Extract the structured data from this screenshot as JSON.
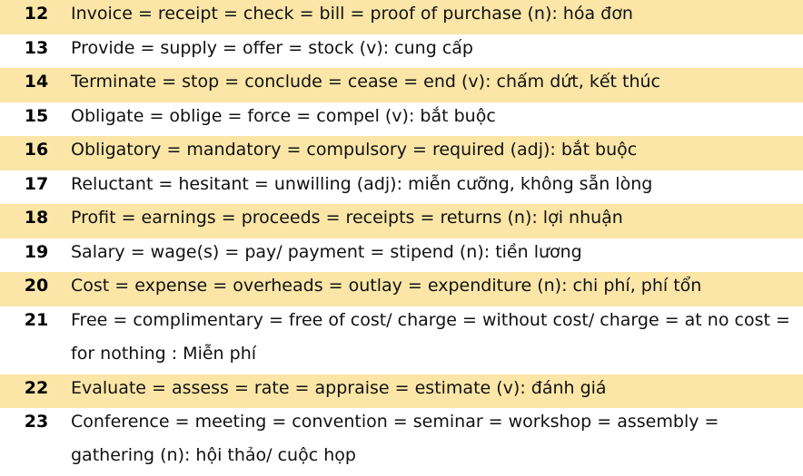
{
  "rows": [
    {
      "num": "12",
      "text": "Invoice = receipt = check = bill = proof of purchase (n): hóa đơn",
      "shaded": true
    },
    {
      "num": "13",
      "text": "Provide = supply = offer = stock (v): cung cấp",
      "shaded": false
    },
    {
      "num": "14",
      "text": "Terminate = stop = conclude = cease = end (v): chấm dứt, kết thúc",
      "shaded": true
    },
    {
      "num": "15",
      "text": "Obligate = oblige = force = compel (v): bắt buộc",
      "shaded": false
    },
    {
      "num": "16",
      "text": "Obligatory = mandatory = compulsory = required (adj): bắt buộc",
      "shaded": true
    },
    {
      "num": "17",
      "text": "Reluctant = hesitant = unwilling (adj): miễn cưỡng, không sẵn lòng",
      "shaded": false
    },
    {
      "num": "18",
      "text": "Profit = earnings = proceeds = receipts = returns (n): lợi nhuận",
      "shaded": true
    },
    {
      "num": "19",
      "text": "Salary = wage(s) = pay/ payment = stipend (n): tiền lương",
      "shaded": false
    },
    {
      "num": "20",
      "text": "Cost = expense = overheads = outlay = expenditure (n): chi phí, phí tổn",
      "shaded": true
    },
    {
      "num": "21",
      "text": "Free = complimentary = free of cost/ charge = without cost/ charge = at no cost = for nothing : Miễn phí",
      "shaded": false
    },
    {
      "num": "22",
      "text": "Evaluate = assess = rate = appraise = estimate (v): đánh giá",
      "shaded": true
    },
    {
      "num": "23",
      "text": "Conference = meeting = convention = seminar = workshop = assembly = gathering (n): hội thảo/ cuộc họp",
      "shaded": false
    }
  ]
}
